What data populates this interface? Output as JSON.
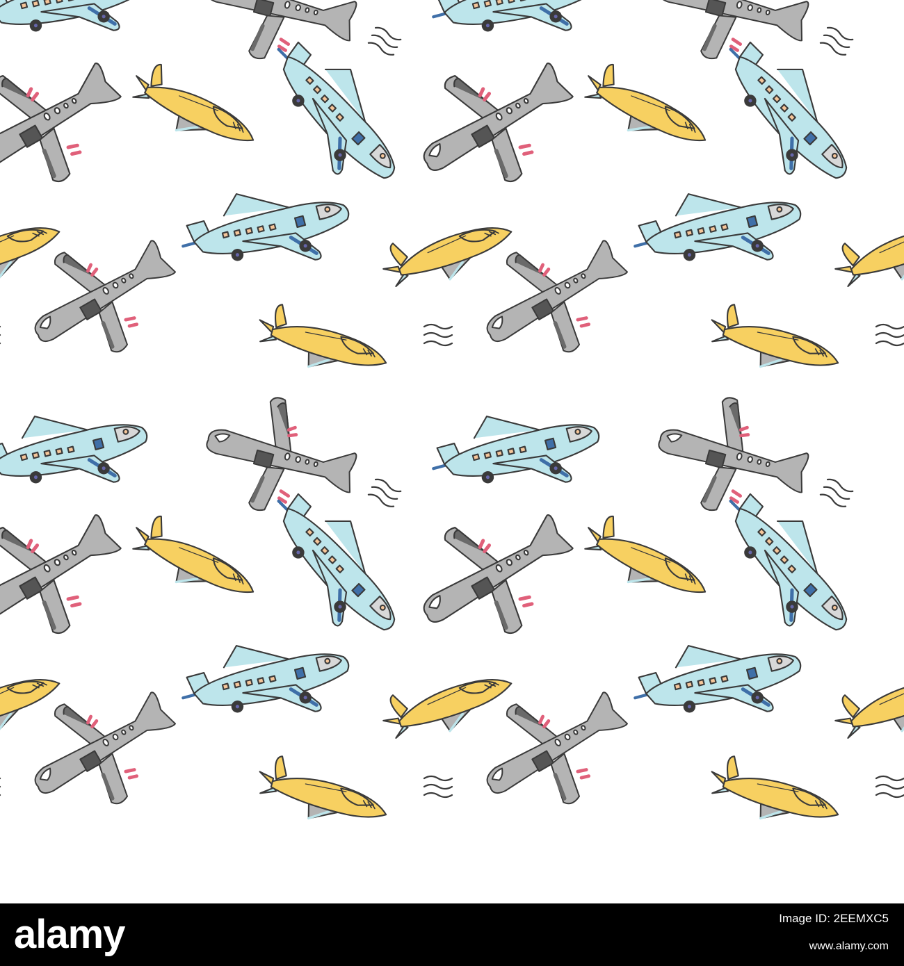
{
  "footer": {
    "logo": "alamy",
    "image_id": "Image ID: 2EEMXC5",
    "url": "www.alamy.com"
  },
  "palette": {
    "outline": "#3a3a3a",
    "light_blue": "#bde5eb",
    "dark_blue": "#3f6fa8",
    "gray": "#b4b4b4",
    "dark_gray": "#6a6a6a",
    "yellow": "#f7d061",
    "pink": "#e0607a",
    "orange_window": "#f6c69a",
    "background": "#ffffff"
  },
  "pattern": {
    "plane_types": [
      "blue-passenger-plane",
      "gray-cargo-plane",
      "yellow-jet"
    ],
    "repeats_horizontally": 2,
    "repeats_vertically": 2
  }
}
